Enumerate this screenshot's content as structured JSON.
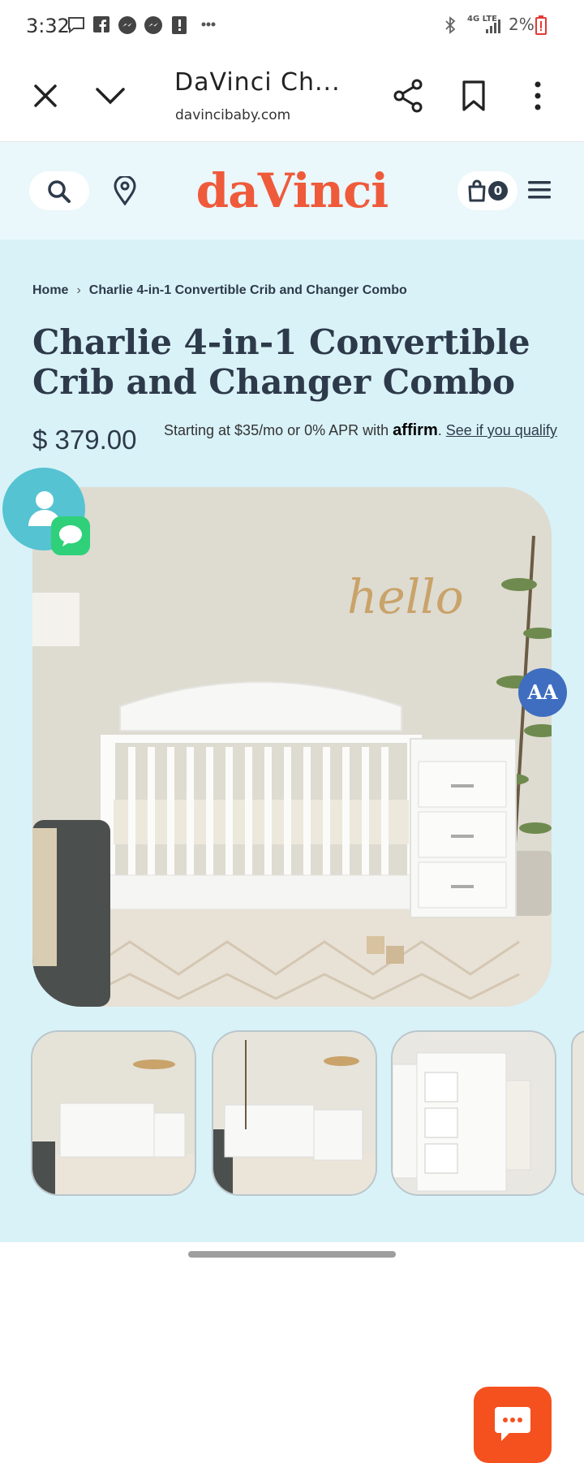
{
  "status_bar": {
    "time": "3:32",
    "battery": "2%",
    "network": "4G LTE"
  },
  "browser": {
    "title": "DaVinci Ch...",
    "url": "davincibaby.com"
  },
  "header": {
    "logo": "daVinci",
    "cart_count": "0"
  },
  "breadcrumb": {
    "home": "Home",
    "current": "Charlie 4-in-1 Convertible Crib and Changer Combo"
  },
  "product": {
    "title": "Charlie 4-in-1 Convertible Crib and Changer Combo",
    "price": "$ 379.00",
    "affirm_prefix": "Starting at $35/mo or 0% APR with",
    "affirm_brand": "affirm",
    "affirm_link": "See if you qualify",
    "hero_wall_text": "hello"
  },
  "accessibility_button": "AA",
  "colors": {
    "brand": "#ef5a3a",
    "header_bg": "#eaf7fb",
    "page_bg": "#d9f2f8",
    "text": "#2d3a4a",
    "chat": "#f4511e",
    "accessibility": "#3f6ec0"
  }
}
